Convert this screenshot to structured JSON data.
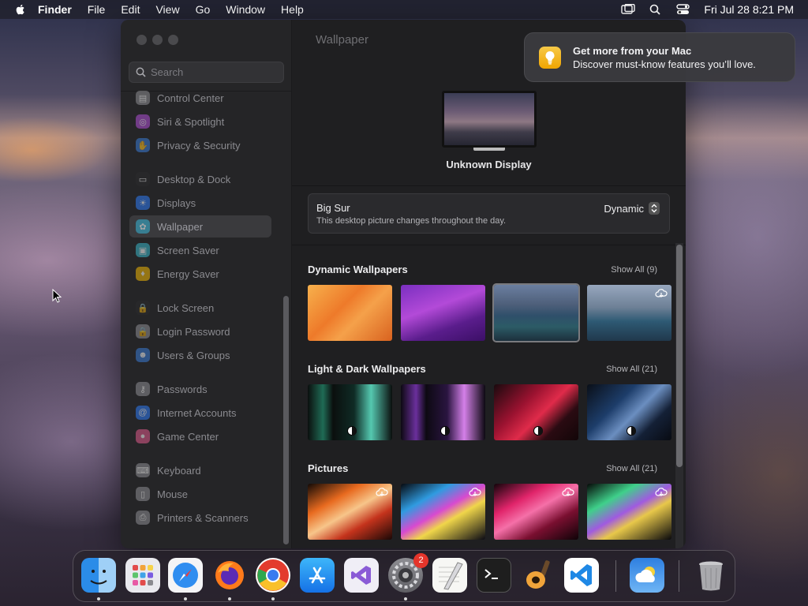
{
  "menubar": {
    "app": "Finder",
    "items": [
      "File",
      "Edit",
      "View",
      "Go",
      "Window",
      "Help"
    ],
    "clock": "Fri Jul 28  8:21 PM"
  },
  "sidebar": {
    "search_placeholder": "Search",
    "items": [
      {
        "label": "Control Center",
        "icon": "control-center-icon",
        "color": "#8e8e93"
      },
      {
        "label": "Siri & Spotlight",
        "icon": "siri-icon",
        "color": "#b04fd6"
      },
      {
        "label": "Privacy & Security",
        "icon": "hand-icon",
        "color": "#3a7bd5"
      },
      {
        "label": "Desktop & Dock",
        "icon": "dock-icon",
        "color": "#2c2c2e"
      },
      {
        "label": "Displays",
        "icon": "sun-icon",
        "color": "#2f7bf5"
      },
      {
        "label": "Wallpaper",
        "icon": "flower-icon",
        "color": "#38b6d8"
      },
      {
        "label": "Screen Saver",
        "icon": "screen-saver-icon",
        "color": "#3ab5c8"
      },
      {
        "label": "Energy Saver",
        "icon": "bulb-icon",
        "color": "#f2b705"
      },
      {
        "label": "Lock Screen",
        "icon": "lock-icon",
        "color": "#2c2c2e"
      },
      {
        "label": "Login Password",
        "icon": "lock-icon",
        "color": "#8e8e93"
      },
      {
        "label": "Users & Groups",
        "icon": "users-icon",
        "color": "#3a7bd5"
      },
      {
        "label": "Passwords",
        "icon": "key-icon",
        "color": "#8e8e93"
      },
      {
        "label": "Internet Accounts",
        "icon": "at-icon",
        "color": "#2f7bf5"
      },
      {
        "label": "Game Center",
        "icon": "game-center-icon",
        "color": "#e05a8c"
      },
      {
        "label": "Keyboard",
        "icon": "keyboard-icon",
        "color": "#8e8e93"
      },
      {
        "label": "Mouse",
        "icon": "mouse-icon",
        "color": "#8e8e93"
      },
      {
        "label": "Printers & Scanners",
        "icon": "printer-icon",
        "color": "#8e8e93"
      }
    ]
  },
  "main": {
    "title": "Wallpaper",
    "display_name": "Unknown Display",
    "current": {
      "name": "Big Sur",
      "description": "This desktop picture changes throughout the day.",
      "mode": "Dynamic"
    },
    "sections": [
      {
        "title": "Dynamic Wallpapers",
        "show_all": "Show All (9)"
      },
      {
        "title": "Light & Dark Wallpapers",
        "show_all": "Show All (21)"
      },
      {
        "title": "Pictures",
        "show_all": "Show All (21)"
      }
    ]
  },
  "notification": {
    "title": "Get more from your Mac",
    "body": "Discover must-know features you’ll love."
  },
  "dock": {
    "apps": [
      "Finder",
      "Launchpad",
      "Safari",
      "Firefox",
      "Chrome",
      "App Store",
      "Visual Studio",
      "System Settings",
      "TextEdit",
      "Terminal",
      "GarageBand",
      "Visual Studio Code",
      "Weather",
      "Trash"
    ],
    "settings_badge": "2"
  }
}
